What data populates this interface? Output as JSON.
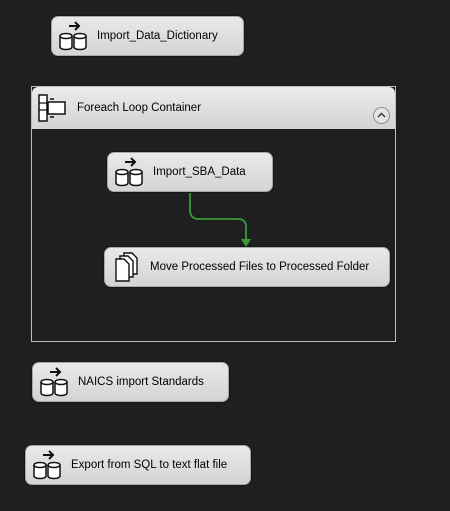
{
  "tasks": {
    "import_data_dictionary": {
      "label": "Import_Data_Dictionary",
      "icon": "data-flow-task-icon"
    },
    "import_sba_data": {
      "label": "Import_SBA_Data",
      "icon": "data-flow-task-icon"
    },
    "move_processed_files": {
      "label": "Move Processed Files to Processed Folder",
      "icon": "file-system-task-icon"
    },
    "naics_import": {
      "label": "NAICS import Standards",
      "icon": "data-flow-task-icon"
    },
    "export_sql": {
      "label": "Export from SQL to text flat file",
      "icon": "data-flow-task-icon"
    }
  },
  "container": {
    "title": "Foreach Loop Container",
    "icon": "foreach-loop-icon",
    "collapse_icon": "collapse-chevron-icon"
  },
  "precedence": {
    "from": "Import_SBA_Data",
    "to": "Move Processed Files to Processed Folder",
    "type": "success",
    "color": "#3a9a3a"
  },
  "colors": {
    "canvas": "#1f1f1f",
    "task_bg": "#dcdcdc",
    "border": "#bdbdbd"
  }
}
